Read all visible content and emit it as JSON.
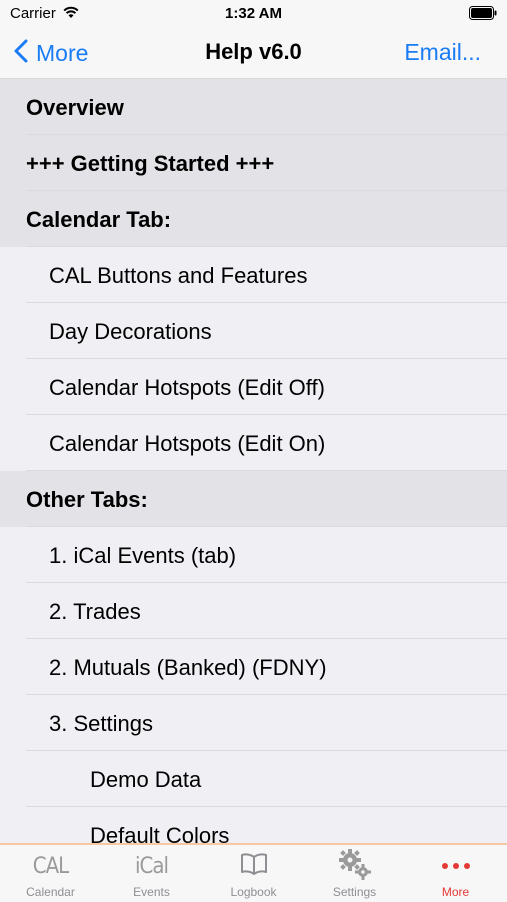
{
  "status": {
    "carrier": "Carrier",
    "time": "1:32 AM"
  },
  "nav": {
    "back_label": "More",
    "title": "Help v6.0",
    "action_label": "Email..."
  },
  "sections": [
    {
      "label": "Overview",
      "level": 0
    },
    {
      "label": "+++ Getting Started +++",
      "level": 0
    },
    {
      "label": "Calendar Tab:",
      "level": 0
    },
    {
      "label": "CAL Buttons and Features",
      "level": 1
    },
    {
      "label": "Day Decorations",
      "level": 1
    },
    {
      "label": "Calendar Hotspots (Edit Off)",
      "level": 1
    },
    {
      "label": "Calendar Hotspots (Edit On)",
      "level": 1
    },
    {
      "label": "Other Tabs:",
      "level": 0
    },
    {
      "label": "1.  iCal Events (tab)",
      "level": 1
    },
    {
      "label": "2.  Trades",
      "level": 1
    },
    {
      "label": "2.  Mutuals (Banked) (FDNY)",
      "level": 1
    },
    {
      "label": "3.  Settings",
      "level": 1
    },
    {
      "label": "Demo Data",
      "level": 2
    },
    {
      "label": "Default Colors",
      "level": 2
    }
  ],
  "tabbar": {
    "active": "More",
    "colors": {
      "active": "#e53935",
      "inactive": "#8e8e93"
    },
    "tabs": [
      {
        "label": "Calendar",
        "icon": "cal-text-icon",
        "icon_text": "CAL"
      },
      {
        "label": "Events",
        "icon": "ical-text-icon",
        "icon_text": "iCal"
      },
      {
        "label": "Logbook",
        "icon": "book-icon"
      },
      {
        "label": "Settings",
        "icon": "gears-icon"
      },
      {
        "label": "More",
        "icon": "more-dots-icon"
      }
    ]
  }
}
